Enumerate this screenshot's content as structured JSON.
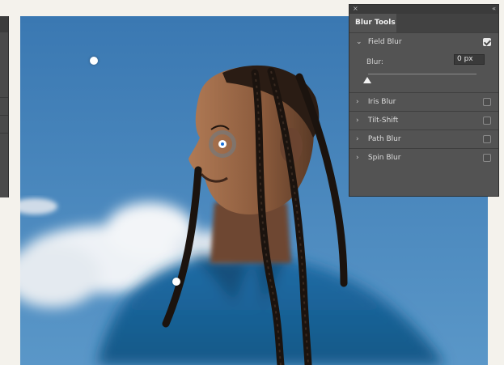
{
  "panel": {
    "close_glyph": "×",
    "collapse_glyph": "«",
    "tab_label": "Blur Tools",
    "field_blur": {
      "label": "Field Blur",
      "checked": true,
      "blur_label": "Blur:",
      "blur_value": "0 px",
      "slider_level": 0
    },
    "sections": [
      {
        "label": "Iris Blur",
        "checked": false
      },
      {
        "label": "Tilt-Shift",
        "checked": false
      },
      {
        "label": "Path Blur",
        "checked": false
      },
      {
        "label": "Spin Blur",
        "checked": false
      }
    ],
    "expanded_chevron": "⌄",
    "collapsed_chevron": "›"
  },
  "canvas": {
    "pins": [
      {
        "name": "blur-pin-sky",
        "active": false
      },
      {
        "name": "blur-pin-face",
        "active": true
      },
      {
        "name": "blur-pin-shirt",
        "active": false
      }
    ]
  },
  "colors": {
    "panel_bg": "#535353",
    "sky": "#3f7fb7",
    "shirt": "#1f6fa8",
    "pin_active_dot": "#1a6fd6"
  }
}
